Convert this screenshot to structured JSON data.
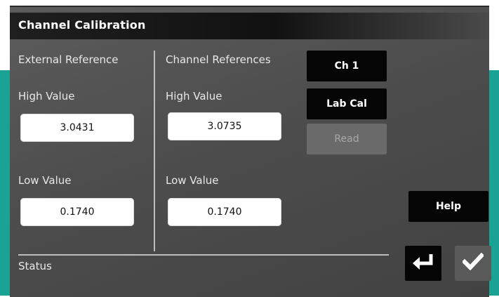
{
  "window": {
    "title": "Channel Calibration"
  },
  "external_reference": {
    "header": "External Reference",
    "high_label": "High Value",
    "high_value": "3.0431",
    "low_label": "Low Value",
    "low_value": "0.1740"
  },
  "channel_references": {
    "header": "Channel References",
    "high_label": "High Value",
    "high_value": "3.0735",
    "low_label": "Low Value",
    "low_value": "0.1740"
  },
  "buttons": {
    "channel": "Ch 1",
    "lab_cal": "Lab Cal",
    "read": "Read",
    "help": "Help"
  },
  "status": {
    "label": "Status"
  },
  "icons": {
    "enter": "enter-arrow-icon",
    "confirm": "checkmark-icon"
  },
  "colors": {
    "bezel": "#1aa395",
    "panel": "#4d4d4d",
    "button": "#050505",
    "disabled_button": "#6a6a6a"
  }
}
